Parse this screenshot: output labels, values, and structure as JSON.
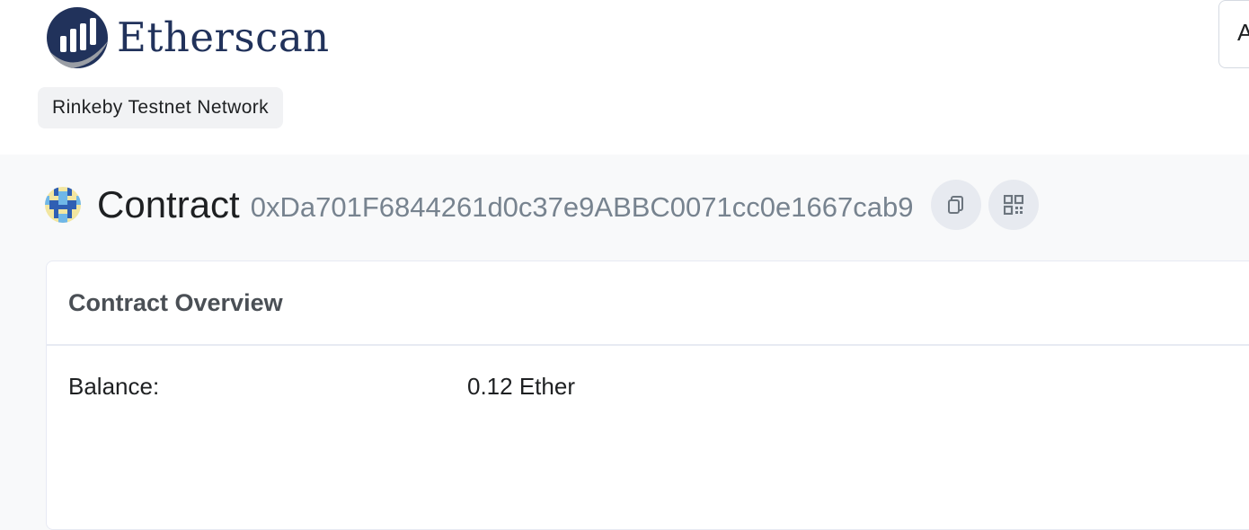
{
  "header": {
    "brand": "Etherscan",
    "network": "Rinkeby Testnet Network",
    "search_partial": "A"
  },
  "page": {
    "title": "Contract",
    "address": "0xDa701F6844261d0c37e9ABBC0071cc0e1667cab9"
  },
  "overview": {
    "heading": "Contract Overview",
    "rows": [
      {
        "label": "Balance:",
        "value": "0.12 Ether"
      }
    ]
  },
  "colors": {
    "brand_navy": "#21325b",
    "address_gray": "#77838f",
    "button_bg": "#e7eaf0"
  },
  "icons": [
    "etherscan-logo",
    "blockie-avatar-icon",
    "copy-icon",
    "qr-code-icon"
  ]
}
